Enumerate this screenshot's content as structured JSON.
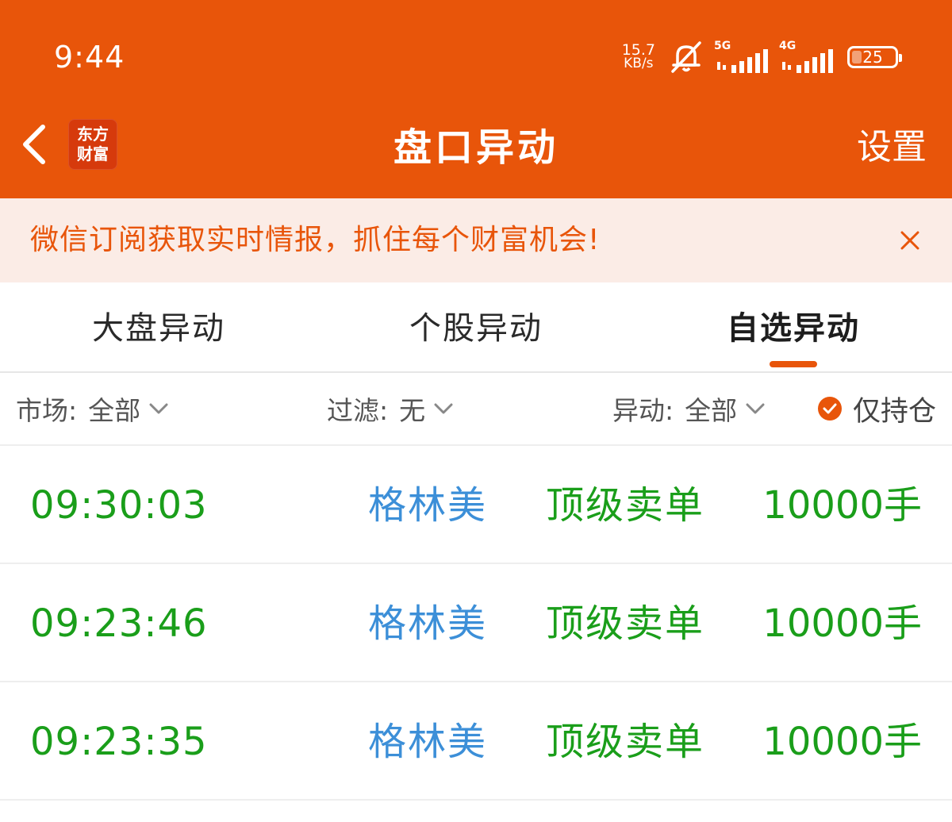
{
  "status_bar": {
    "time": "9:44",
    "net_speed_value": "15.7",
    "net_speed_unit": "KB/s",
    "signal1_tag": "5G",
    "signal2_tag": "4G",
    "battery": "25"
  },
  "nav": {
    "logo_line1": "东方",
    "logo_line2": "财富",
    "title": "盘口异动",
    "settings": "设置"
  },
  "banner": {
    "text": "微信订阅获取实时情报，抓住每个财富机会!"
  },
  "tabs": [
    {
      "label": "大盘异动"
    },
    {
      "label": "个股异动"
    },
    {
      "label": "自选异动",
      "active": true
    }
  ],
  "filters": {
    "market_label": "市场:",
    "market_value": "全部",
    "filter_label": "过滤:",
    "filter_value": "无",
    "change_label": "异动:",
    "change_value": "全部",
    "holdings_only": "仅持仓"
  },
  "rows": [
    {
      "time": "09:30:03",
      "name": "格林美",
      "type": "顶级卖单",
      "volume": "10000手"
    },
    {
      "time": "09:23:46",
      "name": "格林美",
      "type": "顶级卖单",
      "volume": "10000手"
    },
    {
      "time": "09:23:35",
      "name": "格林美",
      "type": "顶级卖单",
      "volume": "10000手"
    }
  ],
  "colors": {
    "brand": "#e8550a",
    "green": "#1a9e1a",
    "blue": "#3c8fd8",
    "banner_bg": "#fbece6"
  }
}
